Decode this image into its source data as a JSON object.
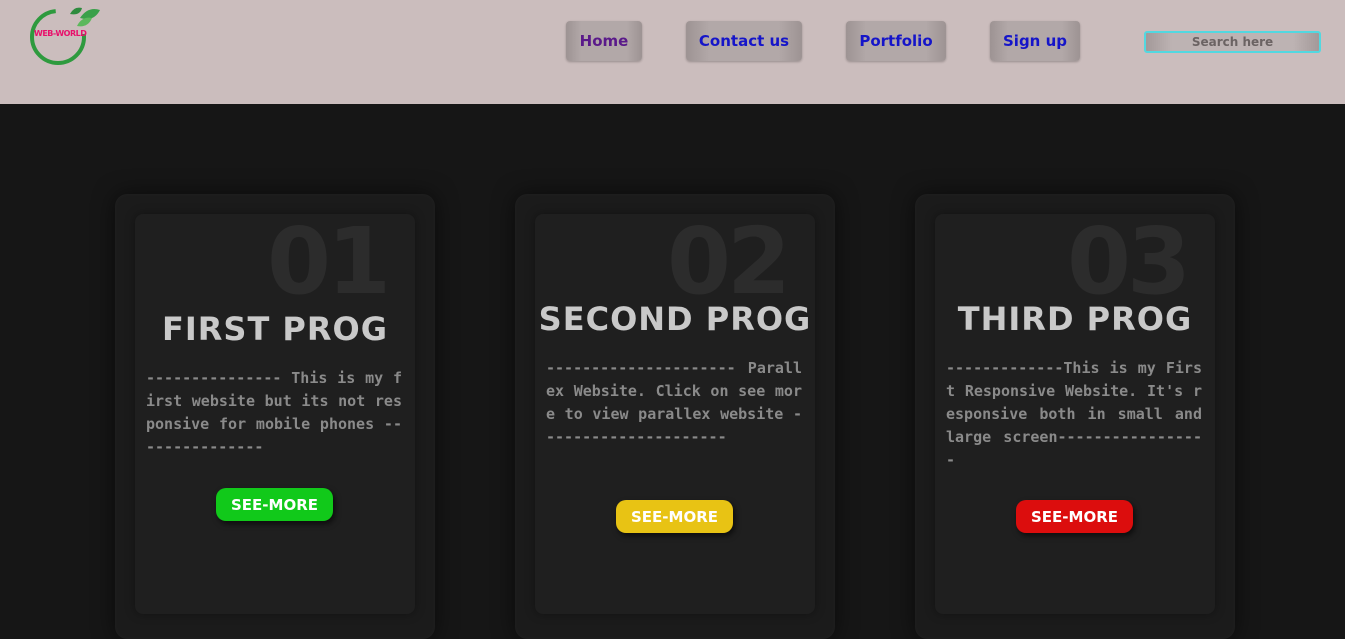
{
  "header": {
    "logo_text": "WEB-WORLD",
    "nav": [
      {
        "label": "Home"
      },
      {
        "label": "Contact us"
      },
      {
        "label": "Portfolio"
      },
      {
        "label": "Sign up"
      }
    ],
    "search": {
      "placeholder": "Search here",
      "value": ""
    }
  },
  "cards": [
    {
      "number": "01",
      "title": "FIRST PROG",
      "text": "--------------- This is my first website but its not responsive for mobile phones ---------------",
      "button": "SEE-MORE",
      "button_color": "#11c91a"
    },
    {
      "number": "02",
      "title": "SECOND PROG",
      "text": "--------------------- Parallex Website. Click on see more to view parallex website ---------------------",
      "button": "SEE-MORE",
      "button_color": "#e8c314"
    },
    {
      "number": "03",
      "title": "THIRD PROG",
      "text": "-------------This is my First Responsive Website. It's responsive both in small and large screen-----------------",
      "button": "SEE-MORE",
      "button_color": "#dc0d0d"
    }
  ]
}
